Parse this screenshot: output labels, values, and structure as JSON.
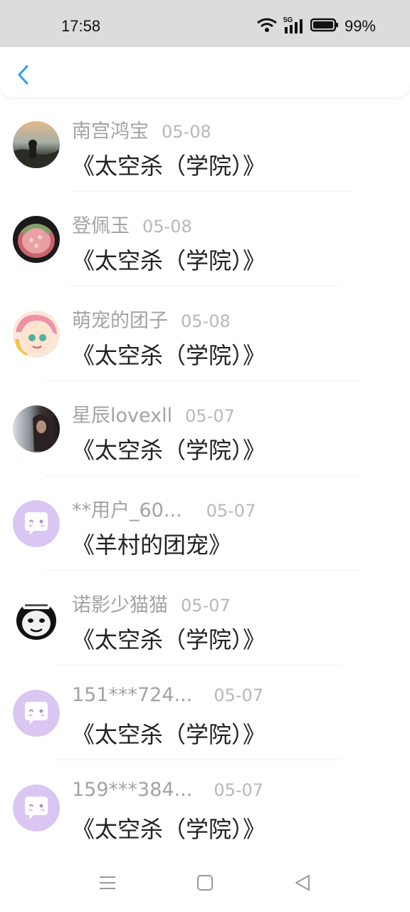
{
  "status_bar": {
    "time": "17:58",
    "network": "5G",
    "battery": "99%",
    "icons": [
      "wifi-icon",
      "signal-icon",
      "battery-icon"
    ]
  },
  "header": {
    "back_icon": "chevron-left-icon",
    "accent_color": "#2a9df4"
  },
  "items": [
    {
      "name": "南宫鸿宝",
      "date": "05-08",
      "title": "《太空杀（学院）》",
      "avatar": "photo"
    },
    {
      "name": "登佩玉",
      "date": "05-08",
      "title": "《太空杀（学院）》",
      "avatar": "photo"
    },
    {
      "name": "萌宠的团子",
      "date": "05-08",
      "title": "《太空杀（学院）》",
      "avatar": "photo"
    },
    {
      "name": "星辰lovexll",
      "date": "05-07",
      "title": "《太空杀（学院）》",
      "avatar": "photo"
    },
    {
      "name": "**用户_60...",
      "date": "05-07",
      "title": "《羊村的团宠》",
      "avatar": "default"
    },
    {
      "name": "诺影少猫猫",
      "date": "05-07",
      "title": "《太空杀（学院）》",
      "avatar": "meme"
    },
    {
      "name": "151***724...",
      "date": "05-07",
      "title": "《太空杀（学院）》",
      "avatar": "default"
    },
    {
      "name": "159***384...",
      "date": "05-07",
      "title": "《太空杀（学院）》",
      "avatar": "default"
    }
  ],
  "nav_bar": {
    "icons": [
      "menu-icon",
      "home-square-icon",
      "back-triangle-icon"
    ]
  }
}
